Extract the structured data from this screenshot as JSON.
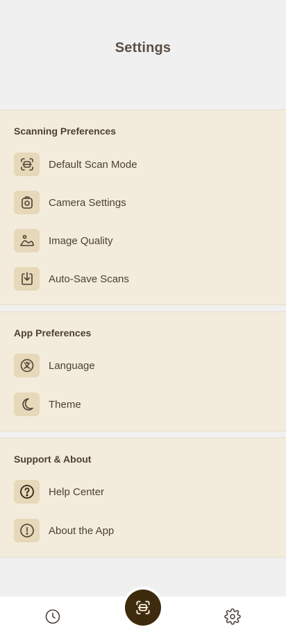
{
  "header": {
    "title": "Settings"
  },
  "sections": [
    {
      "title": "Scanning Preferences",
      "items": [
        {
          "label": "Default Scan Mode",
          "icon": "scan-frame-icon"
        },
        {
          "label": "Camera Settings",
          "icon": "camera-icon"
        },
        {
          "label": "Image Quality",
          "icon": "image-quality-icon"
        },
        {
          "label": "Auto-Save Scans",
          "icon": "download-tray-icon"
        }
      ]
    },
    {
      "title": "App Preferences",
      "items": [
        {
          "label": "Language",
          "icon": "language-icon"
        },
        {
          "label": "Theme",
          "icon": "moon-icon"
        }
      ]
    },
    {
      "title": "Support & About",
      "items": [
        {
          "label": "Help Center",
          "icon": "question-icon"
        },
        {
          "label": "About the App",
          "icon": "info-exclamation-icon"
        }
      ]
    }
  ],
  "bottom_nav": {
    "items": [
      {
        "icon": "history-clock-icon"
      },
      {
        "icon": "scan-icon"
      },
      {
        "icon": "settings-gear-icon"
      }
    ]
  },
  "colors": {
    "background": "#f0f0f0",
    "section_bg": "#f3ecdc",
    "icon_bg": "#e6d8b8",
    "text": "#4a3f35",
    "fab": "#3e2a0c"
  }
}
